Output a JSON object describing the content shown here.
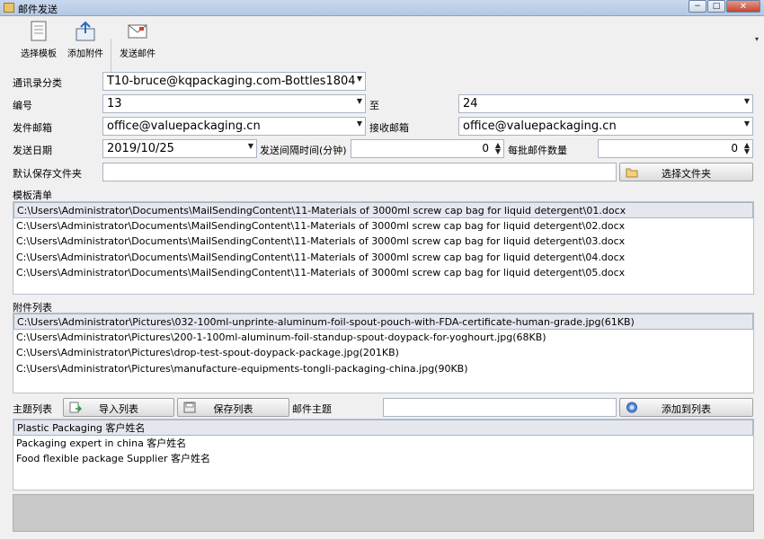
{
  "window": {
    "title": "邮件发送",
    "min": "−",
    "max": "□",
    "close": "✕"
  },
  "toolbar": {
    "choose_template": "选择模板",
    "add_attachment": "添加附件",
    "send_mail": "发送邮件",
    "overflow": "▾"
  },
  "form": {
    "address_book_label": "通讯录分类",
    "address_book_value": "T10-bruce@kqpackaging.com-Bottles1804",
    "number_label": "编号",
    "number_from": "13",
    "to_label": "至",
    "number_to": "24",
    "sender_label": "发件邮箱",
    "sender_value": "office@valuepackaging.cn",
    "receiver_label": "接收邮箱",
    "receiver_value": "office@valuepackaging.cn",
    "date_label": "发送日期",
    "date_value": "2019/10/25",
    "interval_label": "发送间隔时间(分钟)",
    "interval_value": "0",
    "batch_label": "每批邮件数量",
    "batch_value": "0",
    "folder_label": "默认保存文件夹",
    "folder_value": "",
    "choose_folder_button": "选择文件夹"
  },
  "templates": {
    "label": "模板清单",
    "items": [
      "C:\\Users\\Administrator\\Documents\\MailSendingContent\\11-Materials of 3000ml screw cap bag for liquid detergent\\01.docx",
      "C:\\Users\\Administrator\\Documents\\MailSendingContent\\11-Materials of 3000ml screw cap bag for liquid detergent\\02.docx",
      "C:\\Users\\Administrator\\Documents\\MailSendingContent\\11-Materials of 3000ml screw cap bag for liquid detergent\\03.docx",
      "C:\\Users\\Administrator\\Documents\\MailSendingContent\\11-Materials of 3000ml screw cap bag for liquid detergent\\04.docx",
      "C:\\Users\\Administrator\\Documents\\MailSendingContent\\11-Materials of 3000ml screw cap bag for liquid detergent\\05.docx"
    ]
  },
  "attachments": {
    "label": "附件列表",
    "items": [
      "C:\\Users\\Administrator\\Pictures\\032-100ml-unprinte-aluminum-foil-spout-pouch-with-FDA-certificate-human-grade.jpg(61KB)",
      "C:\\Users\\Administrator\\Pictures\\200-1-100ml-aluminum-foil-standup-spout-doypack-for-yoghourt.jpg(68KB)",
      "C:\\Users\\Administrator\\Pictures\\drop-test-spout-doypack-package.jpg(201KB)",
      "C:\\Users\\Administrator\\Pictures\\manufacture-equipments-tongli-packaging-china.jpg(90KB)"
    ]
  },
  "subjects": {
    "label": "主题列表",
    "import_button": "导入列表",
    "save_button": "保存列表",
    "subject_label": "邮件主题",
    "subject_value": "",
    "add_button": "添加到列表",
    "items": [
      "Plastic Packaging 客户姓名",
      "Packaging expert in china 客户姓名",
      "Food flexible package Supplier 客户姓名"
    ]
  }
}
